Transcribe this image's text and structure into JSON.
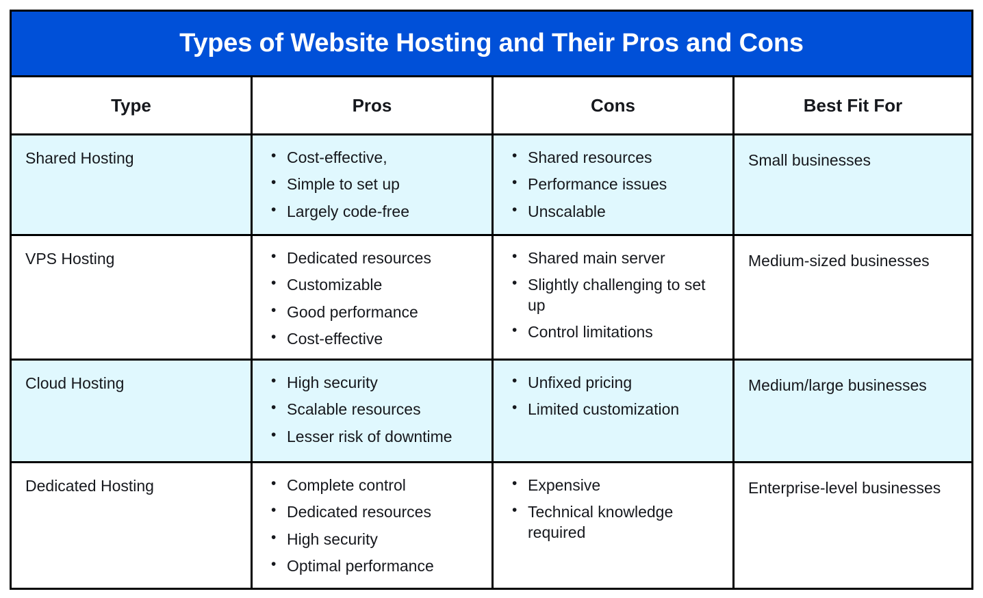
{
  "colors": {
    "header_banner": "#0050D8",
    "row_highlight": "#E0F8FE",
    "border": "#000000",
    "text": "#16181D",
    "header_text": "#FFFFFF"
  },
  "table": {
    "title": "Types of Website Hosting and Their Pros and Cons",
    "columns": [
      {
        "label": "Type"
      },
      {
        "label": "Pros"
      },
      {
        "label": "Cons"
      },
      {
        "label": "Best Fit For"
      }
    ],
    "rows": [
      {
        "type": "Shared Hosting",
        "pros": [
          "Cost-effective,",
          "Simple to set up",
          "Largely code-free"
        ],
        "cons": [
          "Shared resources",
          "Performance issues",
          "Unscalable"
        ],
        "best_fit_for": "Small businesses",
        "highlighted": true
      },
      {
        "type": "VPS Hosting",
        "pros": [
          "Dedicated resources",
          "Customizable",
          "Good performance",
          "Cost-effective"
        ],
        "cons": [
          "Shared main server",
          "Slightly challenging to set up",
          "Control limitations"
        ],
        "best_fit_for": "Medium-sized businesses",
        "highlighted": false
      },
      {
        "type": "Cloud Hosting",
        "pros": [
          "High security",
          "Scalable resources",
          "Lesser risk of downtime"
        ],
        "cons": [
          "Unfixed pricing",
          "Limited customization"
        ],
        "best_fit_for": "Medium/large businesses",
        "highlighted": true
      },
      {
        "type": "Dedicated Hosting",
        "pros": [
          "Complete control",
          "Dedicated resources",
          "High security",
          "Optimal performance"
        ],
        "cons": [
          "Expensive",
          "Technical knowledge required"
        ],
        "best_fit_for": "Enterprise-level businesses",
        "highlighted": false
      }
    ]
  }
}
